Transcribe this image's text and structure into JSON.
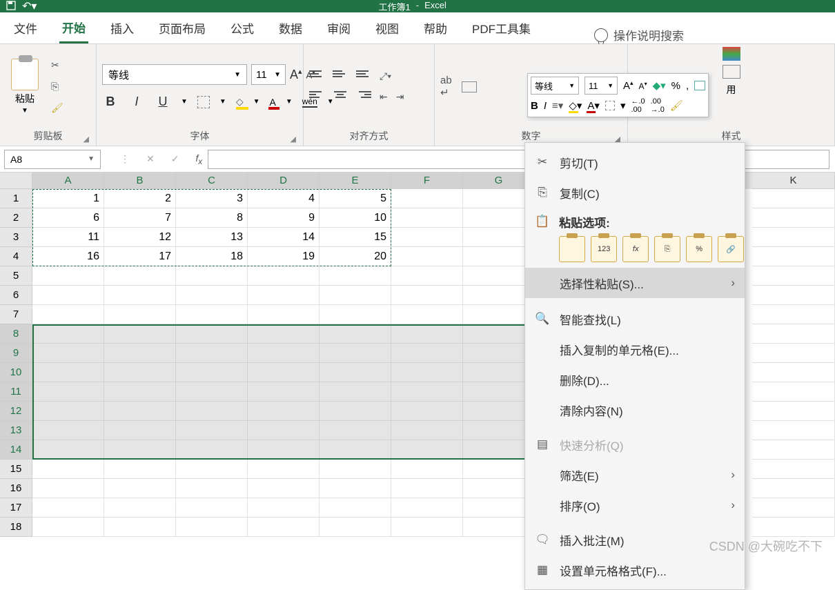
{
  "title_bar": {
    "workbook": "工作簿1",
    "app": "Excel"
  },
  "tabs": [
    "文件",
    "开始",
    "插入",
    "页面布局",
    "公式",
    "数据",
    "审阅",
    "视图",
    "帮助",
    "PDF工具集"
  ],
  "active_tab_index": 1,
  "search_hint": "操作说明搜索",
  "ribbon": {
    "clipboard": {
      "paste": "粘贴",
      "label": "剪贴板"
    },
    "font": {
      "name": "等线",
      "size": "11",
      "label": "字体",
      "bold": "B",
      "italic": "I",
      "underline": "U",
      "wen": "wén"
    },
    "align": {
      "label": "对齐方式"
    },
    "number": {
      "label": "数字"
    },
    "style": {
      "label": "样式",
      "use": "用"
    }
  },
  "namebox": "A8",
  "columns": [
    "A",
    "B",
    "C",
    "D",
    "E",
    "F",
    "G",
    "K"
  ],
  "rows": [
    1,
    2,
    3,
    4,
    5,
    6,
    7,
    8,
    9,
    10,
    11,
    12,
    13,
    14,
    15,
    16,
    17,
    18
  ],
  "grid": [
    [
      1,
      2,
      3,
      4,
      5
    ],
    [
      6,
      7,
      8,
      9,
      10
    ],
    [
      11,
      12,
      13,
      14,
      15
    ],
    [
      16,
      17,
      18,
      19,
      20
    ]
  ],
  "mini_toolbar": {
    "font": "等线",
    "size": "11",
    "bold": "B",
    "italic": "I",
    "pct": "%",
    "dec1": ".0",
    "dec2": ".00"
  },
  "context_menu": {
    "cut": "剪切(T)",
    "copy": "复制(C)",
    "paste_header": "粘贴选项:",
    "paste_opts": [
      "",
      "123",
      "fx",
      "⎘",
      "%",
      "🔗"
    ],
    "paste_special": "选择性粘贴(S)...",
    "smart_lookup": "智能查找(L)",
    "insert_copied": "插入复制的单元格(E)...",
    "delete": "删除(D)...",
    "clear": "清除内容(N)",
    "quick_analysis": "快速分析(Q)",
    "filter": "筛选(E)",
    "sort": "排序(O)",
    "insert_comment": "插入批注(M)",
    "format_cells": "设置单元格格式(F)..."
  },
  "watermark": "CSDN @大碗吃不下"
}
